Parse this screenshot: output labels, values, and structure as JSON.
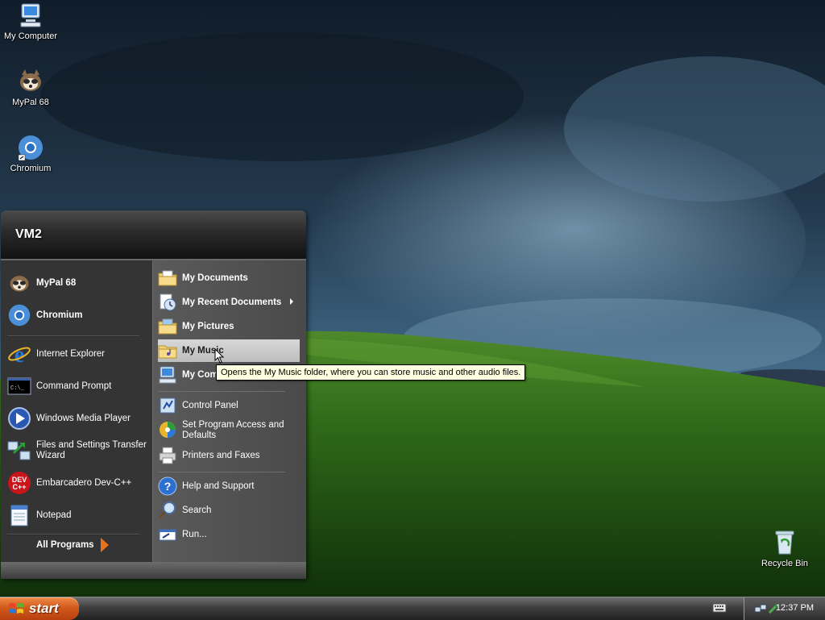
{
  "desktop": {
    "icons": [
      {
        "label": "My Computer",
        "icon": "my-computer-icon"
      },
      {
        "label": "MyPal 68",
        "icon": "mypal-icon"
      },
      {
        "label": "Chromium",
        "icon": "chromium-icon"
      },
      {
        "label": "Recycle Bin",
        "icon": "recycle-bin-icon"
      }
    ]
  },
  "start_menu": {
    "username": "VM2",
    "pinned": [
      {
        "label": "MyPal 68",
        "icon": "mypal-icon"
      },
      {
        "label": "Chromium",
        "icon": "chromium-icon"
      }
    ],
    "recent": [
      {
        "label": "Internet Explorer",
        "icon": "internet-explorer-icon"
      },
      {
        "label": "Command Prompt",
        "icon": "command-prompt-icon"
      },
      {
        "label": "Windows Media Player",
        "icon": "media-player-icon"
      },
      {
        "label": "Files and Settings Transfer Wizard",
        "icon": "transfer-wizard-icon"
      },
      {
        "label": "Embarcadero Dev-C++",
        "icon": "dev-cpp-icon"
      },
      {
        "label": "Notepad",
        "icon": "notepad-icon"
      }
    ],
    "dev_icon_text_1": "DEV",
    "dev_icon_text_2": "C++",
    "cmd_icon_text": "C:\\_",
    "all_programs": "All Programs",
    "places": [
      {
        "label": "My Documents",
        "icon": "folder-documents-icon"
      },
      {
        "label": "My Recent Documents",
        "icon": "recent-documents-icon"
      },
      {
        "label": "My Pictures",
        "icon": "folder-pictures-icon"
      },
      {
        "label": "My Music",
        "icon": "folder-music-icon"
      },
      {
        "label": "My Computer",
        "icon": "my-computer-icon"
      }
    ],
    "system": [
      {
        "label": "Control Panel",
        "icon": "control-panel-icon"
      },
      {
        "label": "Set Program Access and Defaults",
        "icon": "program-access-icon"
      },
      {
        "label": "Printers and Faxes",
        "icon": "printer-icon"
      }
    ],
    "help": [
      {
        "label": "Help and Support",
        "icon": "help-icon"
      },
      {
        "label": "Search",
        "icon": "search-icon"
      },
      {
        "label": "Run...",
        "icon": "run-icon"
      }
    ],
    "my_computer_visible": "My Com",
    "hover_item": "My Music"
  },
  "tooltip": {
    "text": "Opens the My Music folder, where you can store music and other audio files."
  },
  "taskbar": {
    "start_label": "start",
    "clock": "12:37 PM"
  },
  "colors": {
    "start_button": "#d25a1c",
    "taskbar": "#3e3e3e",
    "tooltip_bg": "#ffffe1",
    "menu_right": "#5a5a5a",
    "menu_left": "#343434"
  }
}
